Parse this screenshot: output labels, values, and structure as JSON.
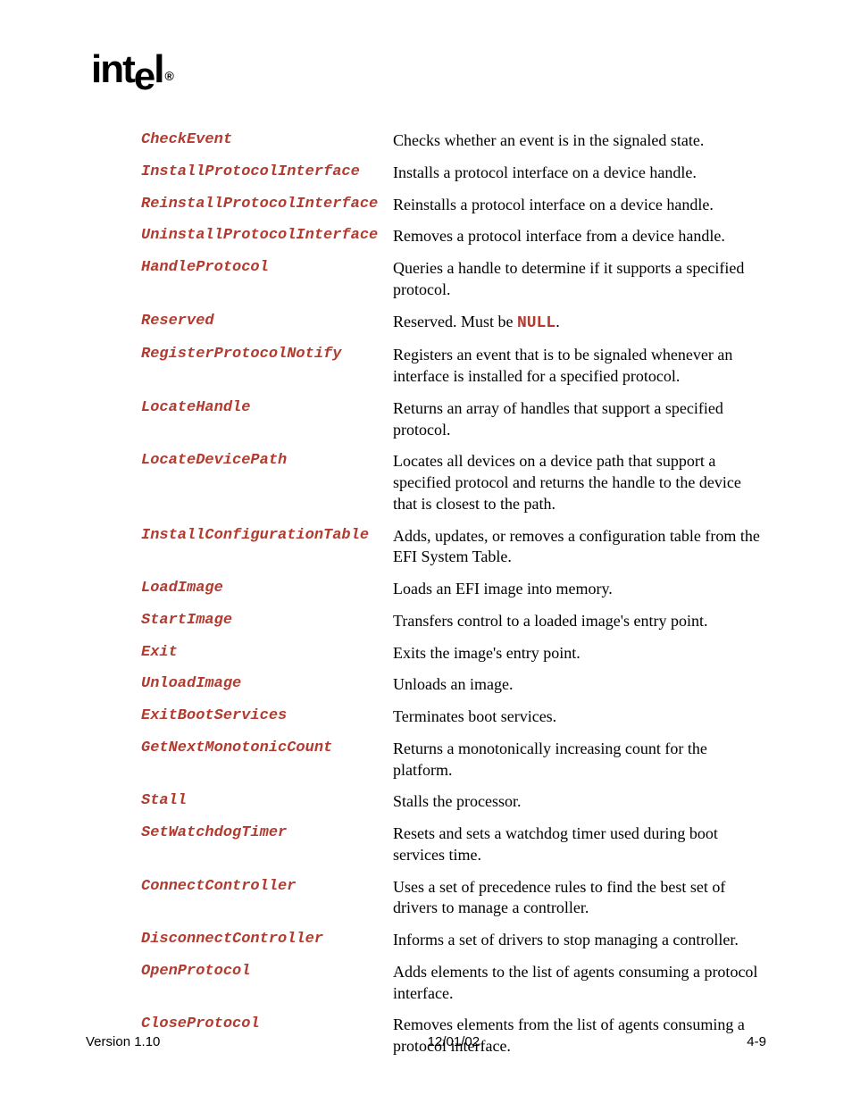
{
  "logo": {
    "text": "intel",
    "trademark": "®"
  },
  "entries": [
    {
      "term": "CheckEvent",
      "desc": "Checks whether an event is in the signaled state."
    },
    {
      "term": "InstallProtocolInterface",
      "desc": "Installs a protocol interface on a device handle."
    },
    {
      "term": "ReinstallProtocolInterface",
      "desc": "Reinstalls a protocol interface on a device handle."
    },
    {
      "term": "UninstallProtocolInterface",
      "desc": "Removes a protocol interface from a device handle."
    },
    {
      "term": "HandleProtocol",
      "desc": "Queries a handle to determine if it supports a specified protocol."
    },
    {
      "term": "Reserved",
      "desc_pre": "Reserved.  Must be ",
      "desc_kw": "NULL",
      "desc_post": "."
    },
    {
      "term": "RegisterProtocolNotify",
      "desc": "Registers an event that is to be signaled whenever an interface is installed for a specified protocol."
    },
    {
      "term": "LocateHandle",
      "desc": "Returns an array of handles that support a specified protocol."
    },
    {
      "term": "LocateDevicePath",
      "desc": "Locates all devices on a device path that support a specified protocol and returns the handle to the device that is closest to the path."
    },
    {
      "term": "InstallConfigurationTable",
      "desc": "Adds, updates, or removes a configuration table from the EFI System Table."
    },
    {
      "term": "LoadImage",
      "desc": "Loads an EFI image into memory."
    },
    {
      "term": "StartImage",
      "desc": "Transfers control to a loaded image's entry point."
    },
    {
      "term": "Exit",
      "desc": "Exits the image's entry point."
    },
    {
      "term": "UnloadImage",
      "desc": "Unloads an image."
    },
    {
      "term": "ExitBootServices",
      "desc": "Terminates boot services."
    },
    {
      "term": "GetNextMonotonicCount",
      "desc": "Returns a monotonically increasing count for the platform."
    },
    {
      "term": "Stall",
      "desc": "Stalls the processor."
    },
    {
      "term": "SetWatchdogTimer",
      "desc": "Resets and sets a watchdog timer used during boot services time."
    },
    {
      "term": "ConnectController",
      "desc": "Uses a set of precedence rules to find the best set of drivers to manage a controller."
    },
    {
      "term": "DisconnectController",
      "desc": "Informs a set of drivers to stop managing a controller."
    },
    {
      "term": "OpenProtocol",
      "desc": "Adds elements to the list of agents consuming a protocol interface."
    },
    {
      "term": "CloseProtocol",
      "desc": "Removes elements from the list of agents consuming a protocol interface."
    }
  ],
  "footer": {
    "left": "Version 1.10",
    "center": "12/01/02",
    "right": "4-9"
  }
}
